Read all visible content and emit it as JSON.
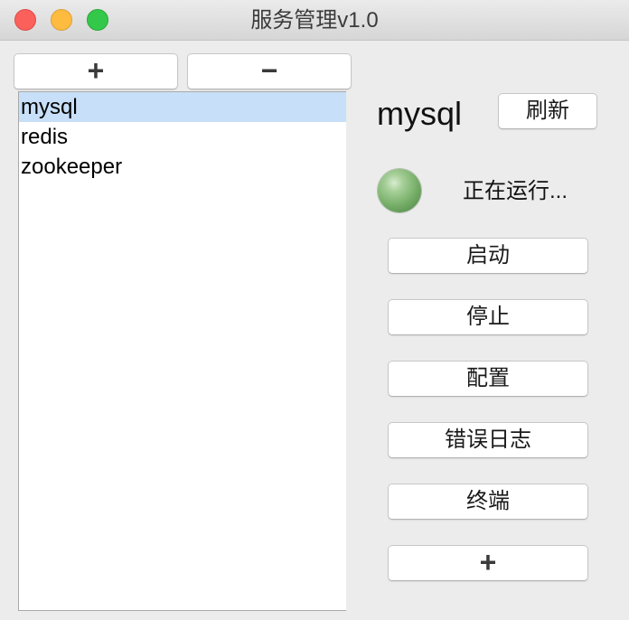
{
  "window": {
    "title": "服务管理v1.0"
  },
  "toolbar": {
    "add_label": "+",
    "remove_label": "−"
  },
  "services": [
    {
      "name": "mysql",
      "selected": true
    },
    {
      "name": "redis",
      "selected": false
    },
    {
      "name": "zookeeper",
      "selected": false
    }
  ],
  "detail": {
    "service_name": "mysql",
    "refresh_label": "刷新",
    "status_text": "正在运行...",
    "status_color": "#78b06a",
    "actions": {
      "start": "启动",
      "stop": "停止",
      "config": "配置",
      "error_log": "错误日志",
      "terminal": "终端",
      "add": "+"
    }
  }
}
